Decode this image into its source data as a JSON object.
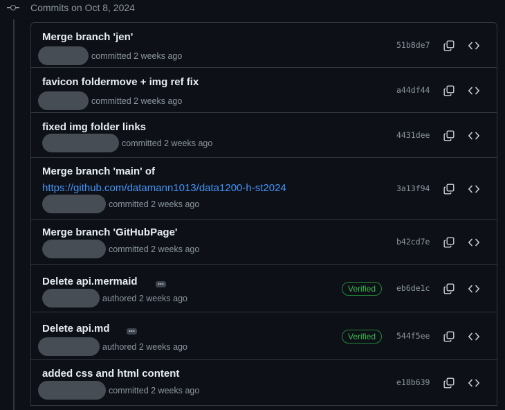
{
  "group": {
    "title": "Commits on Oct 8, 2024",
    "icon": "git-commit-icon"
  },
  "commits": [
    {
      "title": "Merge branch 'jen'",
      "action": "committed 2 weeks ago",
      "sha": "51b8de7",
      "verified": false,
      "link": null
    },
    {
      "title": "favicon foldermove + img ref fix",
      "action": "committed 2 weeks ago",
      "sha": "a44df44",
      "verified": false,
      "link": null
    },
    {
      "title": "fixed img folder links",
      "action": "committed 2 weeks ago",
      "sha": "4431dee",
      "verified": false,
      "link": null
    },
    {
      "title": "Merge branch 'main' of",
      "action": "committed 2 weeks ago",
      "sha": "3a13f94",
      "verified": false,
      "link": "https://github.com/datamann1013/data1200-h-st2024"
    },
    {
      "title": "Merge branch 'GitHubPage'",
      "action": "committed 2 weeks ago",
      "sha": "b42cd7e",
      "verified": false,
      "link": null
    },
    {
      "title": "Delete api.mermaid",
      "action": "authored 2 weeks ago",
      "sha": "eb6de1c",
      "verified": true,
      "link": null
    },
    {
      "title": "Delete api.md",
      "action": "authored 2 weeks ago",
      "sha": "544f5ee",
      "verified": true,
      "link": null
    },
    {
      "title": "added css and html content",
      "action": "committed 2 weeks ago",
      "sha": "e18b639",
      "verified": false,
      "link": null
    }
  ],
  "badge_label": "Verified",
  "icons": {
    "copy": "copy-icon",
    "browse": "code-icon",
    "more": "ellipsis-icon"
  },
  "colors": {
    "background": "#0d1117",
    "border": "#30363d",
    "link": "#4493f8",
    "verified": "#3fb950",
    "muted": "#8d96a0"
  }
}
